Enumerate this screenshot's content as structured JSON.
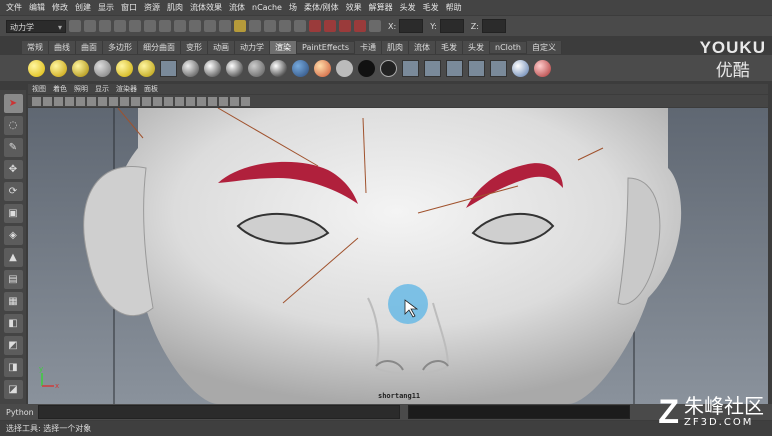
{
  "menubar": {
    "items": [
      "文件",
      "编辑",
      "修改",
      "创建",
      "显示",
      "窗口",
      "资源",
      "肌肉",
      "流体效果",
      "流体",
      "nCache",
      "场",
      "柔体/刚体",
      "效果",
      "解算器",
      "头发",
      "毛发",
      "帮助"
    ]
  },
  "statusline": {
    "mode": "动力学",
    "x_label": "X:",
    "y_label": "Y:",
    "z_label": "Z:"
  },
  "shelf": {
    "tabs": [
      "常规",
      "曲线",
      "曲面",
      "多边形",
      "细分曲面",
      "变形",
      "动画",
      "动力学",
      "渲染",
      "PaintEffects",
      "卡通",
      "肌肉",
      "流体",
      "毛发",
      "头发",
      "nCloth",
      "自定义"
    ],
    "active_tab": "渲染"
  },
  "panel": {
    "menu": [
      "视图",
      "着色",
      "照明",
      "显示",
      "渲染器",
      "面板"
    ]
  },
  "viewport": {
    "hud_text": "shortang11",
    "axis_x": "x",
    "axis_y": "y"
  },
  "cmdline": {
    "label": "Python"
  },
  "helpline": {
    "text": "选择工具: 选择一个对象"
  },
  "watermark": {
    "youku_en": "YOUKU",
    "youku_cn": "优酷",
    "zf_logo": "Z",
    "zf_cn": "朱峰社区",
    "zf_en": "ZF3D.COM"
  },
  "colors": {
    "eyebrow": "#b0203c",
    "cursor_highlight": "#5ab4e6",
    "viewport_bg": "#6e7681"
  }
}
